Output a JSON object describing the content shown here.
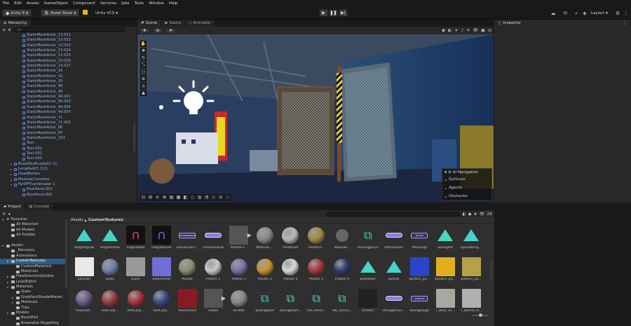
{
  "menu": [
    "File",
    "Edit",
    "Assets",
    "GameObject",
    "Component",
    "Services",
    "Jobs",
    "Tools",
    "Window",
    "Help"
  ],
  "toolbar": {
    "app": "Unity 6",
    "asset_store": "Asset Store",
    "vcs": "Unity VCS",
    "layout": "Layout"
  },
  "hierarchy": {
    "tab": "Hierarchy",
    "add": "+",
    "search_placeholder": "All",
    "items": [
      {
        "name": "StaticMeshActor_13.021",
        "t": "blue",
        "d": 2
      },
      {
        "name": "StaticMeshActor_13.022",
        "t": "blue",
        "d": 2
      },
      {
        "name": "StaticMeshActor_13.023",
        "t": "blue",
        "d": 2
      },
      {
        "name": "StaticMeshActor_13.024",
        "t": "blue",
        "d": 2
      },
      {
        "name": "StaticMeshActor_13.025",
        "t": "blue",
        "d": 2
      },
      {
        "name": "StaticMeshActor_13.026",
        "t": "blue",
        "d": 2
      },
      {
        "name": "StaticMeshActor_13.027",
        "t": "blue",
        "d": 2
      },
      {
        "name": "StaticMeshActor_16",
        "t": "blue",
        "d": 2
      },
      {
        "name": "StaticMeshActor_32",
        "t": "blue",
        "d": 2
      },
      {
        "name": "StaticMeshActor_33",
        "t": "blue",
        "d": 2
      },
      {
        "name": "StaticMeshActor_48",
        "t": "blue",
        "d": 2
      },
      {
        "name": "StaticMeshActor_49",
        "t": "blue",
        "d": 2
      },
      {
        "name": "StaticMeshActor_49.002",
        "t": "blue",
        "d": 2
      },
      {
        "name": "StaticMeshActor_49.003",
        "t": "blue",
        "d": 2
      },
      {
        "name": "StaticMeshActor_49.004",
        "t": "blue",
        "d": 2
      },
      {
        "name": "StaticMeshActor_49.005",
        "t": "blue",
        "d": 2
      },
      {
        "name": "StaticMeshActor_71",
        "t": "blue",
        "d": 2
      },
      {
        "name": "StaticMeshActor_71.002",
        "t": "blue",
        "d": 2
      },
      {
        "name": "StaticMeshActor_86",
        "t": "blue",
        "d": 2
      },
      {
        "name": "StaticMeshActor_87",
        "t": "blue",
        "d": 2
      },
      {
        "name": "StaticMeshActor_253",
        "t": "blue",
        "d": 2
      },
      {
        "name": "Text",
        "t": "blue",
        "d": 2
      },
      {
        "name": "Text.001",
        "t": "blue",
        "d": 2
      },
      {
        "name": "Text.002",
        "t": "blue",
        "d": 2
      },
      {
        "name": "Text.003",
        "t": "blue",
        "d": 2
      },
      {
        "name": "BoostPadPuzzle02 (1)",
        "t": "blue",
        "d": 1,
        "c": "▸"
      },
      {
        "name": "JumpPadV1 (12)",
        "t": "blue",
        "d": 1,
        "c": "▸"
      },
      {
        "name": "DeadBodies",
        "t": "blue",
        "d": 1,
        "c": "▸"
      },
      {
        "name": "ModularConsoles",
        "t": "blue",
        "d": 1,
        "c": "▸"
      },
      {
        "name": "FanPFThandmaker 1",
        "t": "blue",
        "d": 1,
        "c": "▾"
      },
      {
        "name": "BlueHand.001",
        "t": "blue",
        "d": 2
      },
      {
        "name": "BlueHand.002",
        "t": "blue",
        "d": 2
      }
    ]
  },
  "scene": {
    "tabs": [
      "Scene",
      "Game",
      "Animator"
    ],
    "ai_nav": {
      "title": "AI Navigation",
      "items": [
        "Surfaces",
        "Agents",
        "Obstacles"
      ]
    }
  },
  "inspector": {
    "tab": "Inspector"
  },
  "project": {
    "tabs": [
      "Project",
      "Console"
    ],
    "breadcrumb": [
      "Assets",
      "CustomTextures"
    ],
    "count": "26",
    "tree": [
      {
        "name": "Favorites",
        "d": 0,
        "c": "▾",
        "star": true
      },
      {
        "name": "All Materials",
        "d": 1
      },
      {
        "name": "All Models",
        "d": 1
      },
      {
        "name": "All Prefabs",
        "d": 1
      },
      {
        "name": "",
        "d": 0
      },
      {
        "name": "Assets",
        "d": 0,
        "c": "▾"
      },
      {
        "name": "_Recovery",
        "d": 1
      },
      {
        "name": "Animations",
        "d": 1
      },
      {
        "name": "CustomTextures",
        "d": 1,
        "c": "▾",
        "sel": true
      },
      {
        "name": "CustomMaterials",
        "d": 2
      },
      {
        "name": "Materials",
        "d": 2
      },
      {
        "name": "FreeSelectionOutline",
        "d": 1,
        "c": "▸"
      },
      {
        "name": "LevelEditor",
        "d": 1,
        "c": "▸"
      },
      {
        "name": "Materials",
        "d": 1,
        "c": "▾"
      },
      {
        "name": "Glass",
        "d": 2
      },
      {
        "name": "GrabPackShaderMateri",
        "d": 2,
        "c": "▸"
      },
      {
        "name": "Materials",
        "d": 2,
        "c": "▸"
      },
      {
        "name": "Tiles",
        "d": 2
      },
      {
        "name": "Models",
        "d": 1,
        "c": "▾"
      },
      {
        "name": "BoostPad",
        "d": 2
      },
      {
        "name": "Breakable MugeHing",
        "d": 2
      }
    ],
    "assets_rows": [
      [
        {
          "n": "magnetgrab",
          "k": "tri"
        },
        {
          "n": "magnetslide",
          "k": "tri"
        },
        {
          "n": "magnetpull",
          "k": "magnet"
        },
        {
          "n": "magnetpush",
          "k": "magnet"
        },
        {
          "n": "maintenanc...",
          "k": "lbl",
          "tx": "MAINTENANCE"
        },
        {
          "n": "maintenanat",
          "k": "bar"
        },
        {
          "n": "Market F...",
          "k": "prefab"
        },
        {
          "n": "Material ...",
          "k": "sphere",
          "c": "#8a8a8a"
        },
        {
          "n": "metalroof",
          "k": "sphere",
          "c": "#b8b8b8"
        },
        {
          "n": "metalno...",
          "k": "sphere",
          "c": "#a08a3c"
        },
        {
          "n": "Modular...",
          "k": "prefab2"
        },
        {
          "n": "movingpiece",
          "k": "link"
        },
        {
          "n": "officeportal",
          "k": "bar"
        },
        {
          "n": "officesign",
          "k": "lbl",
          "tx": "OFFICE"
        },
        {
          "n": "opengate",
          "k": "tri"
        },
        {
          "n": "openabling...",
          "k": "tri"
        }
      ],
      [
        {
          "n": "panelan",
          "k": "tex",
          "c": "#e8e8e8"
        },
        {
          "n": "pipes",
          "k": "sphere",
          "c": "#6a7fa8"
        },
        {
          "n": "pipes",
          "k": "tex",
          "c": "#9a9a9a"
        },
        {
          "n": "pipesmmat",
          "k": "tex",
          "c": "#6f6fd8"
        },
        {
          "n": "Plaster",
          "k": "sphere",
          "c": "#8f8f6f"
        },
        {
          "n": "Plaster 1",
          "k": "sphere",
          "c": "#c8c8c8"
        },
        {
          "n": "Plaster 2",
          "k": "sphere",
          "c": "#7a6fa8"
        },
        {
          "n": "Plaster 3",
          "k": "sphere",
          "c": "#c9922f"
        },
        {
          "n": "Plaster 4",
          "k": "sphere",
          "c": "#d8d8d8"
        },
        {
          "n": "Plaster 5",
          "k": "sphere",
          "c": "#a8343a"
        },
        {
          "n": "Plaster 6",
          "k": "sphere",
          "c": "#2f3a6f"
        },
        {
          "n": "poledown",
          "k": "tri"
        },
        {
          "n": "poleup",
          "k": "tri"
        },
        {
          "n": "posters_po...",
          "k": "tex",
          "c": "#2845c8"
        },
        {
          "n": "posters_po...",
          "k": "tex",
          "c": "#e0b020"
        },
        {
          "n": "posters_po...",
          "k": "tex",
          "c": "#b8a048"
        }
      ],
      [
        {
          "n": "PurpleBr...",
          "k": "sphere",
          "c": "#6a5a8a"
        },
        {
          "n": "RedCarp...",
          "k": "sphere",
          "c": "#9a3a3a"
        },
        {
          "n": "RedCarp...",
          "k": "sphere",
          "c": "#a8303a"
        },
        {
          "n": "RedCarp...",
          "k": "sphere",
          "c": "#3a4a8a"
        },
        {
          "n": "RedTexture",
          "k": "tex",
          "c": "#8a1a22"
        },
        {
          "n": "rubble",
          "k": "prefab"
        },
        {
          "n": "Shutter",
          "k": "sphere",
          "c": "#8a8a8a"
        },
        {
          "n": "SlidingDoor",
          "k": "link"
        },
        {
          "n": "slidingdoort...",
          "k": "link"
        },
        {
          "n": "SM_Fence...",
          "k": "link"
        },
        {
          "n": "SM_Tunnel...",
          "k": "link"
        },
        {
          "n": "stickers",
          "k": "tex",
          "c": "#222"
        },
        {
          "n": "storagemon...",
          "k": "bar"
        },
        {
          "n": "StorageSign",
          "k": "lbl",
          "tx": "STORAGE"
        },
        {
          "n": "T_Altar_01...",
          "k": "tex",
          "c": "#a8a8a0"
        },
        {
          "n": "T_Barrier_A...",
          "k": "tex",
          "c": "#b0b0b0"
        }
      ]
    ]
  },
  "colors": {
    "accent": "#47d4c8",
    "selection": "#2c5d87",
    "hier_blue": "#8fb2ee",
    "bg": "#191919",
    "panel": "#282828"
  }
}
